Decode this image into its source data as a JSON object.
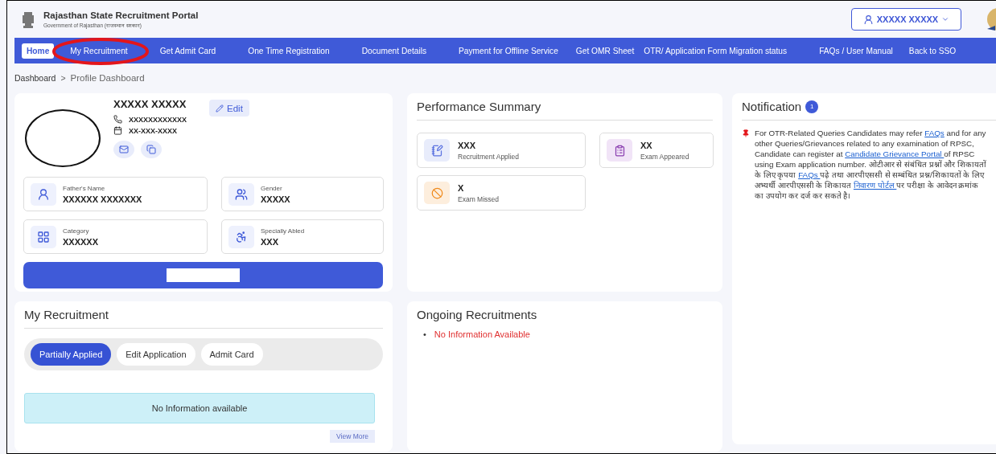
{
  "header": {
    "title": "Rajasthan State Recruitment Portal",
    "subtitle": "Government of Rajasthan (राजस्थान सरकार)",
    "user_name": "XXXXX XXXXX"
  },
  "nav": [
    {
      "label": "Home",
      "selected": true,
      "circled": false
    },
    {
      "label": "My Recruitment",
      "selected": false,
      "circled": true
    },
    {
      "label": "Get Admit Card",
      "selected": false,
      "circled": false
    },
    {
      "label": "One Time Registration",
      "selected": false,
      "circled": false
    },
    {
      "label": "Document Details",
      "selected": false,
      "circled": false
    },
    {
      "label": "Payment for Offline Service",
      "selected": false,
      "circled": false
    },
    {
      "label": "Get OMR Sheet",
      "selected": false,
      "circled": false
    },
    {
      "label": "OTR/ Application Form Migration status",
      "selected": false,
      "circled": false
    },
    {
      "label": "FAQs / User Manual",
      "selected": false,
      "circled": false
    },
    {
      "label": "Back to SSO",
      "selected": false,
      "circled": false
    }
  ],
  "breadcrumb": {
    "items": [
      "Dashboard",
      "Profile Dashboard"
    ],
    "separator": ">"
  },
  "profile": {
    "name": "XXXXX XXXXX",
    "phone": "XXXXXXXXXXXX",
    "dob": "XX-XXX-XXXX",
    "edit_label": "Edit",
    "fields": [
      {
        "kind": "person",
        "label": "Father's Name",
        "value": "XXXXXX XXXXXXX"
      },
      {
        "kind": "gender",
        "label": "Gender",
        "value": "XXXXX"
      },
      {
        "kind": "category",
        "label": "Category",
        "value": "XXXXXX"
      },
      {
        "kind": "accessible",
        "label": "Specially Abled",
        "value": "XXX"
      }
    ]
  },
  "performance": {
    "title": "Performance Summary",
    "stats": [
      {
        "kind": "applied",
        "value": "XXX",
        "label": "Recruitment Applied"
      },
      {
        "kind": "appeared",
        "value": "XX",
        "label": "Exam Appeared"
      },
      {
        "kind": "missed",
        "value": "X",
        "label": "Exam Missed"
      }
    ]
  },
  "notification": {
    "title": "Notification",
    "count": "1",
    "segments": [
      {
        "kind": "text",
        "text": "For OTR-Related Queries Candidates may refer "
      },
      {
        "kind": "link",
        "text": "FAQs"
      },
      {
        "kind": "text",
        "text": " and for any other Queries/Grievances related to any examination of RPSC, Candidate can register at "
      },
      {
        "kind": "link",
        "text": "Candidate Grievance Portal "
      },
      {
        "kind": "text",
        "text": "of RPSC using Exam application number. ओटीआर से संबंधित प्रश्नों और शिकायतों के लिए कृपया "
      },
      {
        "kind": "link",
        "text": "FAQs "
      },
      {
        "kind": "text",
        "text": "पढ़े तथा आरपीएससी से सम्बंधित प्रश्न/शिकायतों के लिए अभ्यर्थी आरपीएससी के शिकायत "
      },
      {
        "kind": "link",
        "text": "निवारण पोर्टल "
      },
      {
        "kind": "text",
        "text": "पर परीक्षा के आवेदन क्रमांक का उपयोग कर दर्ज कर सकते है।"
      }
    ]
  },
  "my_recruitment": {
    "title": "My Recruitment",
    "tabs": [
      {
        "label": "Partially Applied",
        "selected": true
      },
      {
        "label": "Edit Application",
        "selected": false
      },
      {
        "label": "Admit Card",
        "selected": false
      }
    ],
    "message": "No Information available",
    "view_more": "View More"
  },
  "ongoing": {
    "title": "Ongoing Recruitments",
    "items": [
      {
        "bullet": "•",
        "text": "No Information Available"
      }
    ]
  }
}
